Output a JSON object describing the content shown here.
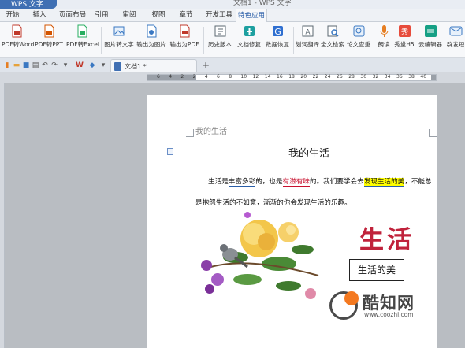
{
  "window": {
    "app_badge": "WPS 文字",
    "title": "文档1 - WPS 文字"
  },
  "menu": {
    "tabs": [
      "开始",
      "插入",
      "页面布局",
      "引用",
      "审阅",
      "视图",
      "章节",
      "开发工具",
      "特色应用"
    ],
    "active": "特色应用"
  },
  "ribbon": {
    "buttons": [
      {
        "label": "PDF转Word",
        "icon": "pdf-to-word-icon",
        "color": "#c0392b"
      },
      {
        "label": "PDF转PPT",
        "icon": "pdf-to-ppt-icon",
        "color": "#d35400"
      },
      {
        "label": "PDF转Excel",
        "icon": "pdf-to-excel-icon",
        "color": "#27ae60"
      },
      {
        "label": "图片转文字",
        "icon": "image-to-text-icon",
        "color": "#3a78c2"
      },
      {
        "label": "输出为图片",
        "icon": "export-image-icon",
        "color": "#3a78c2"
      },
      {
        "label": "输出为PDF",
        "icon": "export-pdf-icon",
        "color": "#c0392b"
      },
      {
        "label": "历史版本",
        "icon": "history-icon",
        "color": "#5b6770"
      },
      {
        "label": "文档修复",
        "icon": "repair-icon",
        "color": "#1ea0a0"
      },
      {
        "label": "数据恢复",
        "icon": "data-recovery-icon",
        "color": "#2f6fd0"
      },
      {
        "label": "划词翻译",
        "icon": "translate-icon",
        "color": "#5b6770"
      },
      {
        "label": "全文检索",
        "icon": "search-icon",
        "color": "#5b6770"
      },
      {
        "label": "论文查重",
        "icon": "plagiarism-check-icon",
        "color": "#3a78c2"
      },
      {
        "label": "朗读",
        "icon": "read-aloud-icon",
        "color": "#e67e22"
      },
      {
        "label": "秀堂H5",
        "icon": "h5-icon",
        "color": "#e74c3c"
      },
      {
        "label": "云编辑器",
        "icon": "cloud-editor-icon",
        "color": "#16a085"
      },
      {
        "label": "群发短",
        "icon": "mass-sms-icon",
        "color": "#3a78c2"
      }
    ]
  },
  "quick_access": {
    "icons": [
      "new-doc-icon",
      "open-icon",
      "save-icon",
      "print-icon",
      "undo-icon",
      "redo-icon",
      "dropdown-icon",
      "wps-logo-icon",
      "cloud-icon"
    ]
  },
  "doc_tabs": {
    "tabs": [
      "文档1 *"
    ],
    "new_tab": "+"
  },
  "ruler": {
    "numbers": [
      "6",
      "4",
      "2",
      "2",
      "4",
      "6",
      "8",
      "10",
      "12",
      "14",
      "16",
      "18",
      "20",
      "22",
      "24",
      "26",
      "28",
      "30",
      "32",
      "34",
      "36",
      "38",
      "40"
    ]
  },
  "document": {
    "header": "我的生活",
    "heading": "我的生活",
    "line1": {
      "p1": "生活是",
      "p2": "丰富多彩",
      "p3": "的，也是",
      "p4": "有滋有味",
      "p5": "的。我们要学会去",
      "p6": "发现生活的美",
      "p7": "，不能总"
    },
    "line2": "是抱怨生活的不如意，渐渐的你会发现生活的乐趣。",
    "art_text": "生活",
    "textbox": "生活的美"
  },
  "watermark": {
    "name": "酷知网",
    "url": "www.coozhi.com"
  }
}
